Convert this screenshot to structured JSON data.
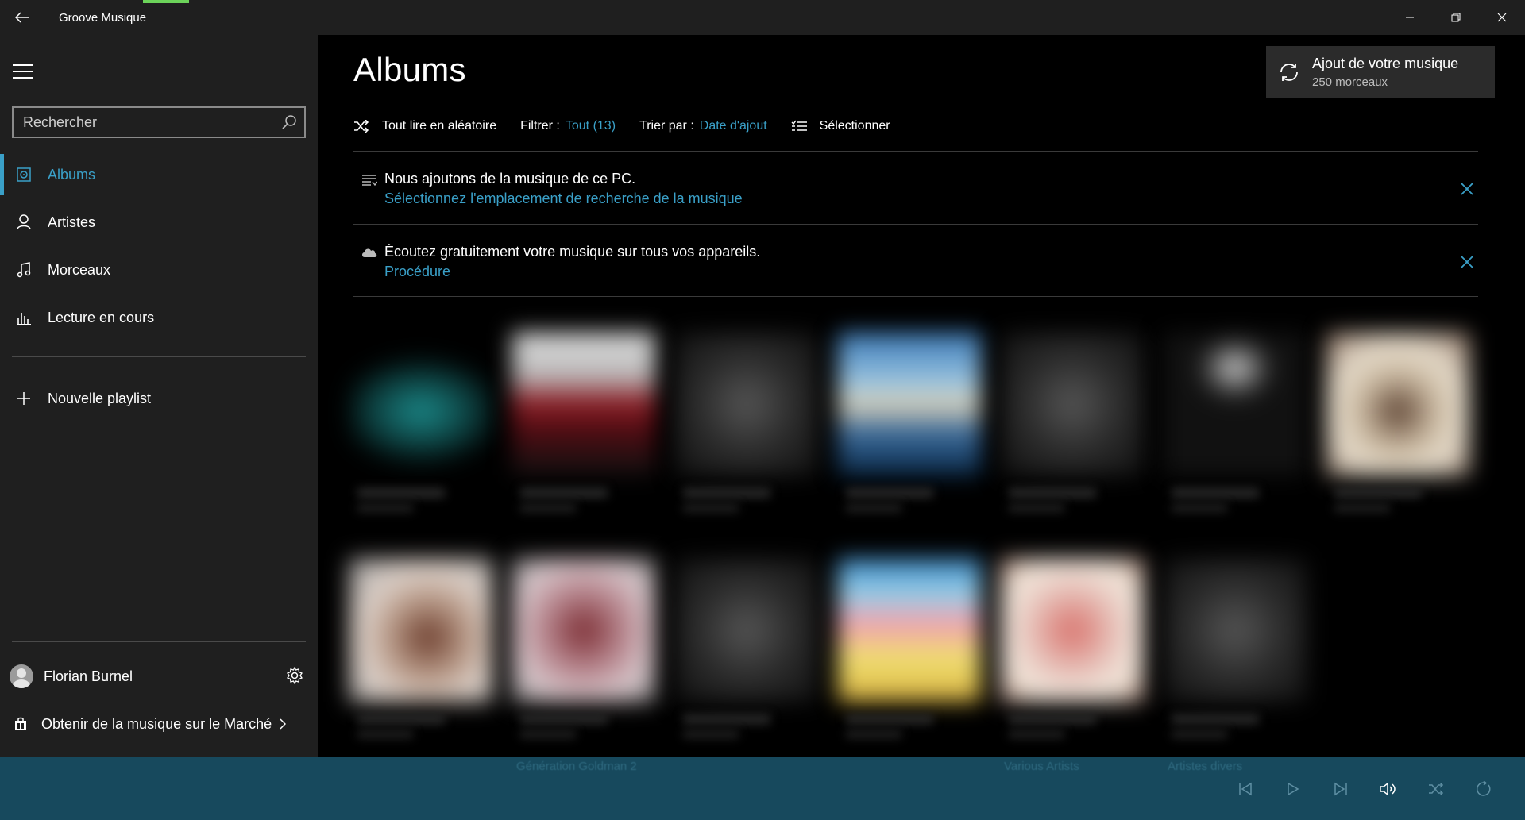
{
  "window": {
    "title": "Groove Musique"
  },
  "sidebar": {
    "search_placeholder": "Rechercher",
    "items": [
      {
        "label": "Albums"
      },
      {
        "label": "Artistes"
      },
      {
        "label": "Morceaux"
      },
      {
        "label": "Lecture en cours"
      }
    ],
    "new_playlist": "Nouvelle playlist",
    "user_name": "Florian Burnel",
    "store_label": "Obtenir de la musique sur le Marché"
  },
  "main": {
    "title": "Albums",
    "add_music": {
      "title": "Ajout de votre musique",
      "subtitle": "250 morceaux"
    },
    "toolbar": {
      "shuffle_all": "Tout lire en aléatoire",
      "filter_label": "Filtrer :",
      "filter_value": "Tout (13)",
      "sort_label": "Trier par :",
      "sort_value": "Date d'ajout",
      "select": "Sélectionner"
    },
    "notices": [
      {
        "text": "Nous ajoutons de la musique de ce PC.",
        "link": "Sélectionnez l'emplacement de recherche de la musique"
      },
      {
        "text": "Écoutez gratuitement votre musique sur tous vos appareils.",
        "link": "Procédure"
      }
    ]
  },
  "player": {
    "faint_labels": [
      "Génération Goldman 2",
      "Various Artists",
      "Artistes divers"
    ]
  },
  "colors": {
    "accent": "#3aa0c8",
    "player_bar": "#17495d",
    "sidebar_bg": "#1f1f1f",
    "title_bar_accent": "#6cd35a"
  }
}
